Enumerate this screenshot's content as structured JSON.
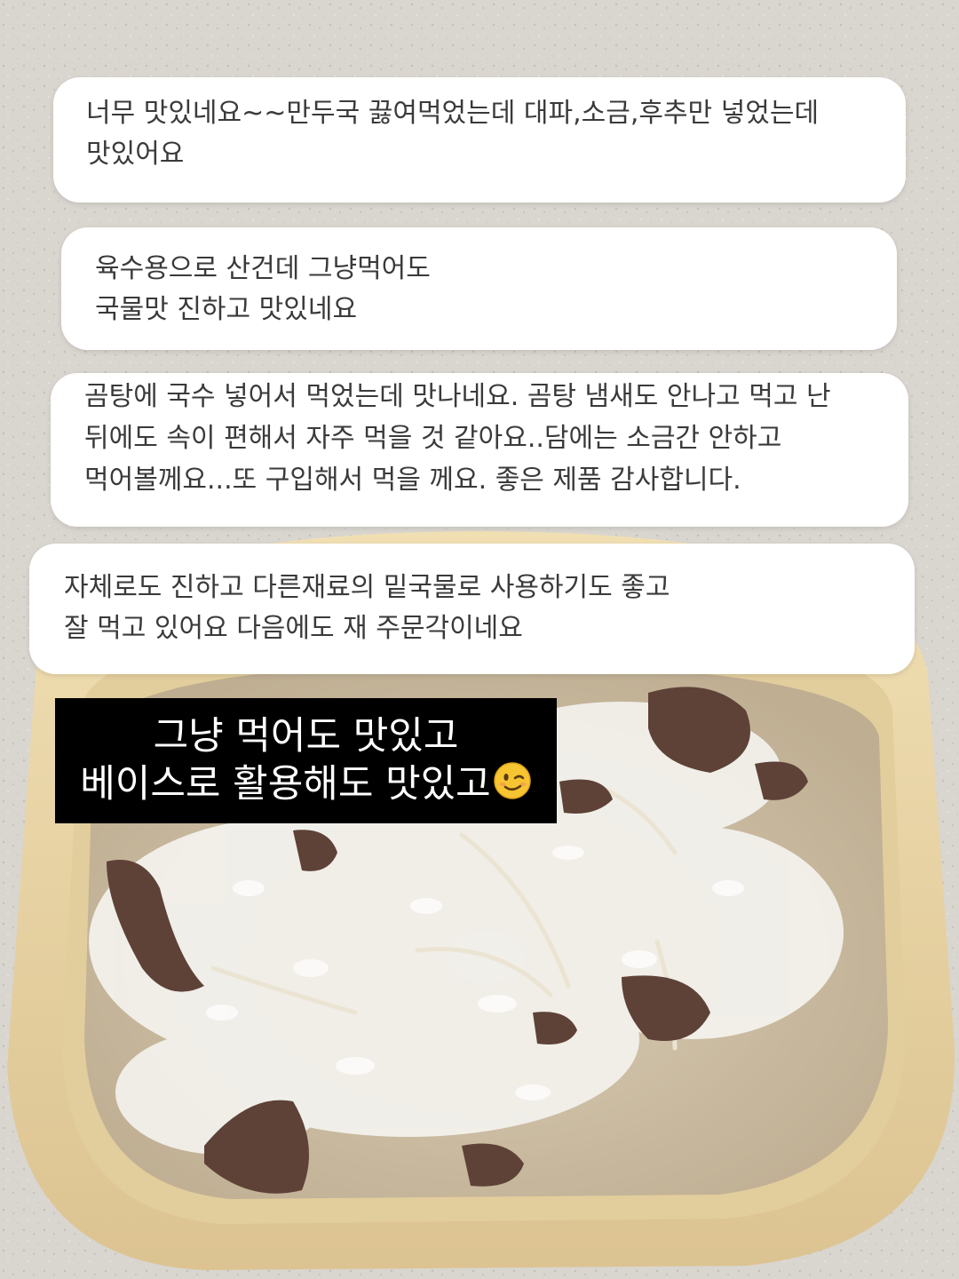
{
  "reviews": [
    {
      "lines": [
        "너무 맛있네요~~만두국  끓여먹었는데 대파,소금,후추만 넣었는데",
        "맛있어요"
      ]
    },
    {
      "lines": [
        "육수용으로 산건데 그냥먹어도",
        "국물맛 진하고 맛있네요"
      ]
    },
    {
      "lines": [
        "곰탕에 국수 넣어서 먹었는데 맛나네요. 곰탕 냄새도 안나고 먹고 난",
        "뒤에도 속이 편해서 자주 먹을 것 같아요..담에는 소금간 안하고",
        "먹어볼께요...또 구입해서 먹을 께요. 좋은 제품 감사합니다."
      ]
    },
    {
      "lines": [
        "자체로도 진하고 다른재료의 밑국물로 사용하기도 좋고",
        "잘 먹고 있어요 다음에도 재 주문각이네요"
      ]
    }
  ],
  "caption": {
    "line1": "그냥 먹어도 맛있고",
    "line2": "베이스로 활용해도 맛있고",
    "emoji": "winking-face-icon"
  },
  "colors": {
    "countertop": "#d9d5cf",
    "bowl": "#e9d6a6",
    "soup": "#cdbfa6",
    "rice": "#f2f0ea",
    "beef": "#5e4237",
    "bubble": "#ffffff",
    "caption_bg": "#000000",
    "caption_text": "#ffffff"
  }
}
